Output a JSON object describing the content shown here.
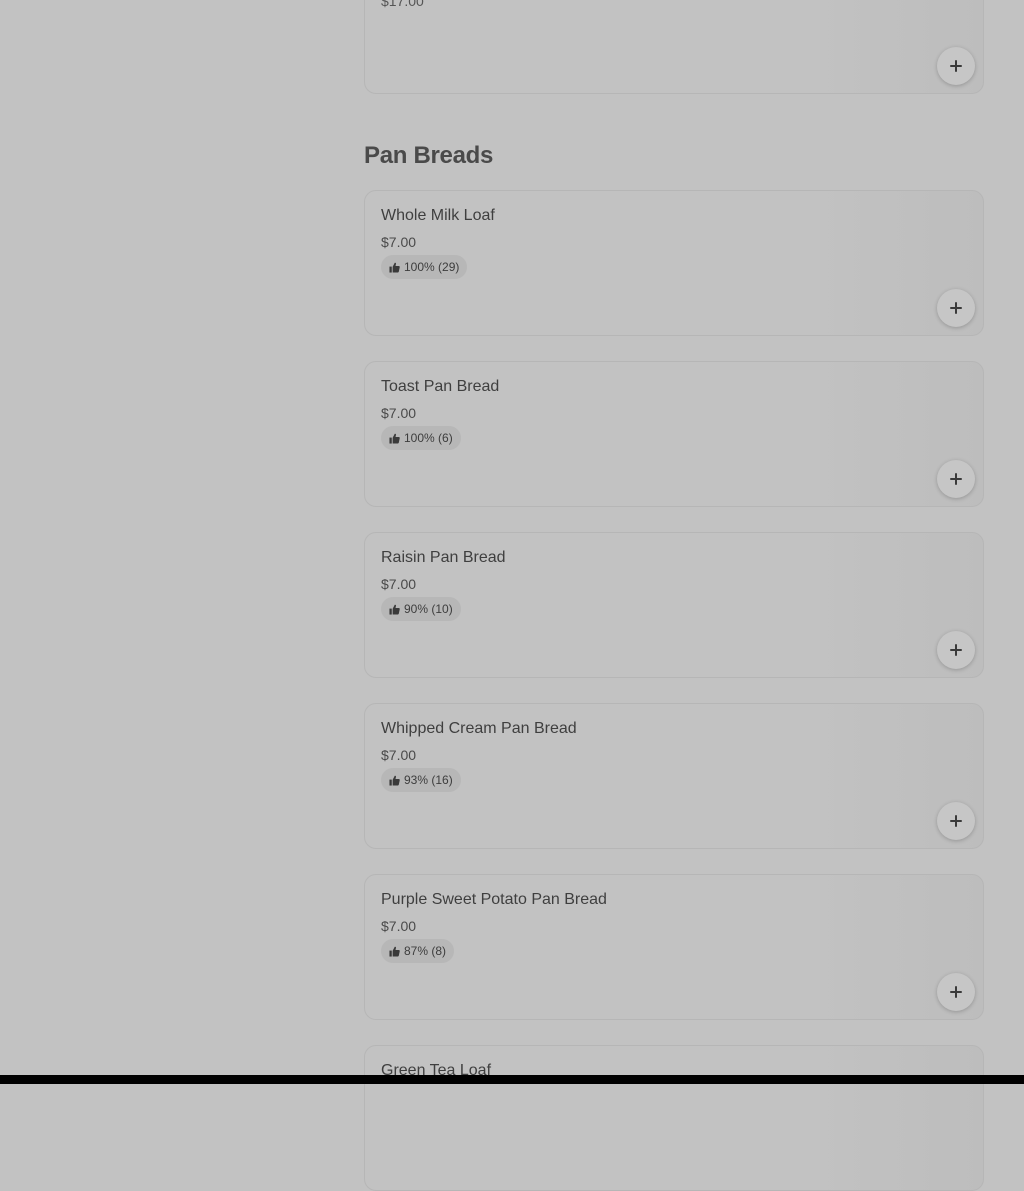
{
  "previous_card": {
    "price": "$17.00"
  },
  "section": {
    "title": "Pan Breads"
  },
  "items": [
    {
      "name": "Whole Milk Loaf",
      "price": "$7.00",
      "rating": "100% (29)"
    },
    {
      "name": "Toast Pan Bread",
      "price": "$7.00",
      "rating": "100% (6)"
    },
    {
      "name": "Raisin Pan Bread",
      "price": "$7.00",
      "rating": "90% (10)"
    },
    {
      "name": "Whipped Cream Pan Bread",
      "price": "$7.00",
      "rating": "93% (16)"
    },
    {
      "name": "Purple Sweet Potato Pan Bread",
      "price": "$7.00",
      "rating": "87% (8)"
    },
    {
      "name": "Green Tea Loaf"
    }
  ],
  "icons": {
    "rating": "thumbs-up-icon",
    "add": "plus-icon"
  }
}
